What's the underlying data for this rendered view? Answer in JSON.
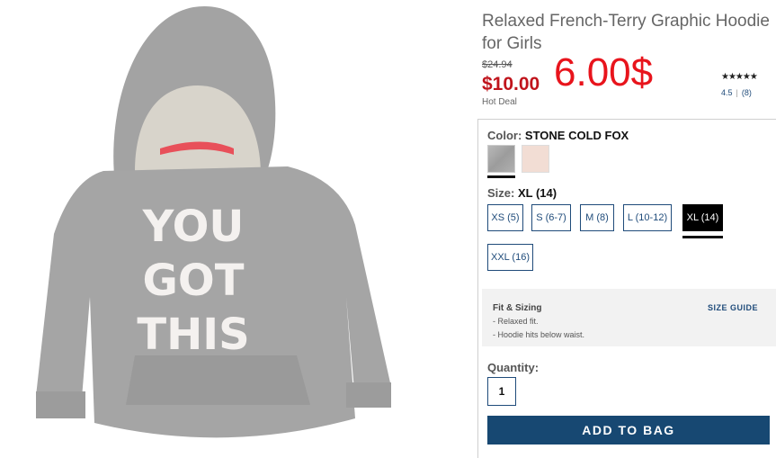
{
  "product": {
    "title": "Relaxed French-Terry Graphic Hoodie for Girls",
    "image_text": "YOU GOT THIS",
    "original_price": "$24.94",
    "sale_price": "$10.00",
    "deal_label": "Hot Deal",
    "overlay_price": "6.00$"
  },
  "rating": {
    "stars": "★★★★★",
    "score": "4.5",
    "reviews": "(8)"
  },
  "color": {
    "label": "Color:",
    "selected": "STONE COLD FOX",
    "swatches": [
      {
        "name": "grey",
        "hex": "#a8a8a8",
        "selected": true
      },
      {
        "name": "pink",
        "hex": "#f2ddd4",
        "selected": false
      }
    ]
  },
  "size": {
    "label": "Size:",
    "selected": "XL (14)",
    "options": [
      "XS (5)",
      "S (6-7)",
      "M (8)",
      "L (10-12)",
      "XL (14)",
      "XXL (16)"
    ]
  },
  "fit": {
    "title": "Fit & Sizing",
    "guide_link": "SIZE GUIDE",
    "items": [
      "- Relaxed fit.",
      "- Hoodie hits below waist."
    ]
  },
  "quantity": {
    "label": "Quantity:",
    "value": "1"
  },
  "cart": {
    "add_label": "ADD TO BAG",
    "color": "#174872"
  }
}
